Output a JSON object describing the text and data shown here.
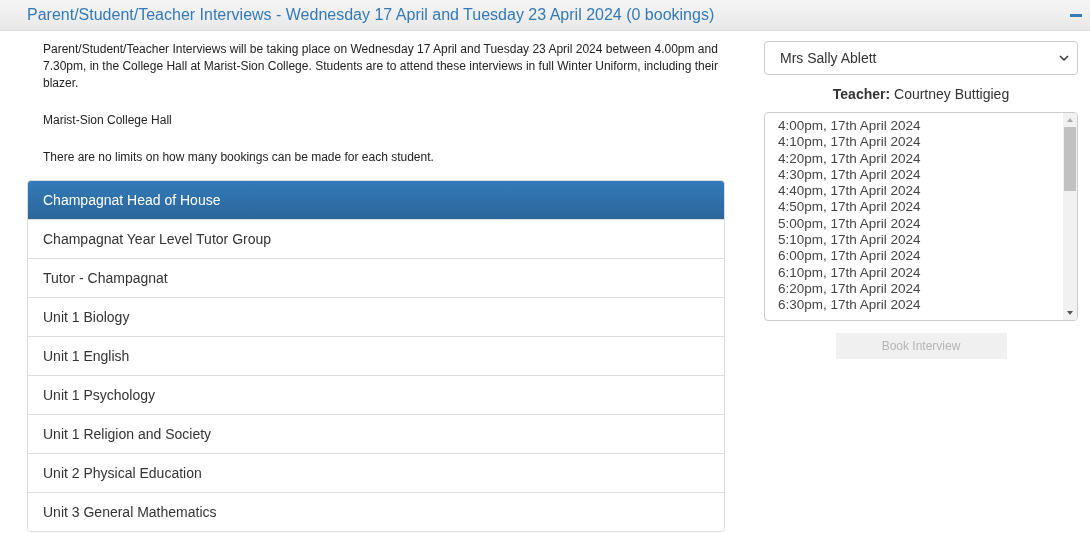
{
  "header": {
    "title": "Parent/Student/Teacher Interviews - Wednesday 17 April and Tuesday 23 April 2024 (0 bookings)",
    "expanded": true
  },
  "info": [
    "Parent/Student/Teacher Interviews will be taking place on Wednesday 17 April and Tuesday 23 April 2024 between 4.00pm and 7.30pm, in the College Hall at Marist-Sion College. Students are to attend these interviews in full Winter Uniform, including their blazer.",
    "Marist-Sion College Hall",
    "There are no limits on how many bookings can be made for each student."
  ],
  "classes": [
    {
      "label": "Champagnat Head of House",
      "selected": true
    },
    {
      "label": "Champagnat Year Level Tutor Group",
      "selected": false
    },
    {
      "label": "Tutor - Champagnat",
      "selected": false
    },
    {
      "label": "Unit 1 Biology",
      "selected": false
    },
    {
      "label": "Unit 1 English",
      "selected": false
    },
    {
      "label": "Unit 1 Psychology",
      "selected": false
    },
    {
      "label": "Unit 1 Religion and Society",
      "selected": false
    },
    {
      "label": "Unit 2 Physical Education",
      "selected": false
    },
    {
      "label": "Unit 3 General Mathematics",
      "selected": false
    }
  ],
  "teacher_select": {
    "value": "Mrs Sally Ablett"
  },
  "teacher": {
    "label": "Teacher:",
    "name": "Courtney Buttigieg"
  },
  "times": [
    "4:00pm, 17th April 2024",
    "4:10pm, 17th April 2024",
    "4:20pm, 17th April 2024",
    "4:30pm, 17th April 2024",
    "4:40pm, 17th April 2024",
    "4:50pm, 17th April 2024",
    "5:00pm, 17th April 2024",
    "5:10pm, 17th April 2024",
    "6:00pm, 17th April 2024",
    "6:10pm, 17th April 2024",
    "6:20pm, 17th April 2024",
    "6:30pm, 17th April 2024"
  ],
  "book_button": {
    "label": "Book Interview",
    "disabled": true
  }
}
